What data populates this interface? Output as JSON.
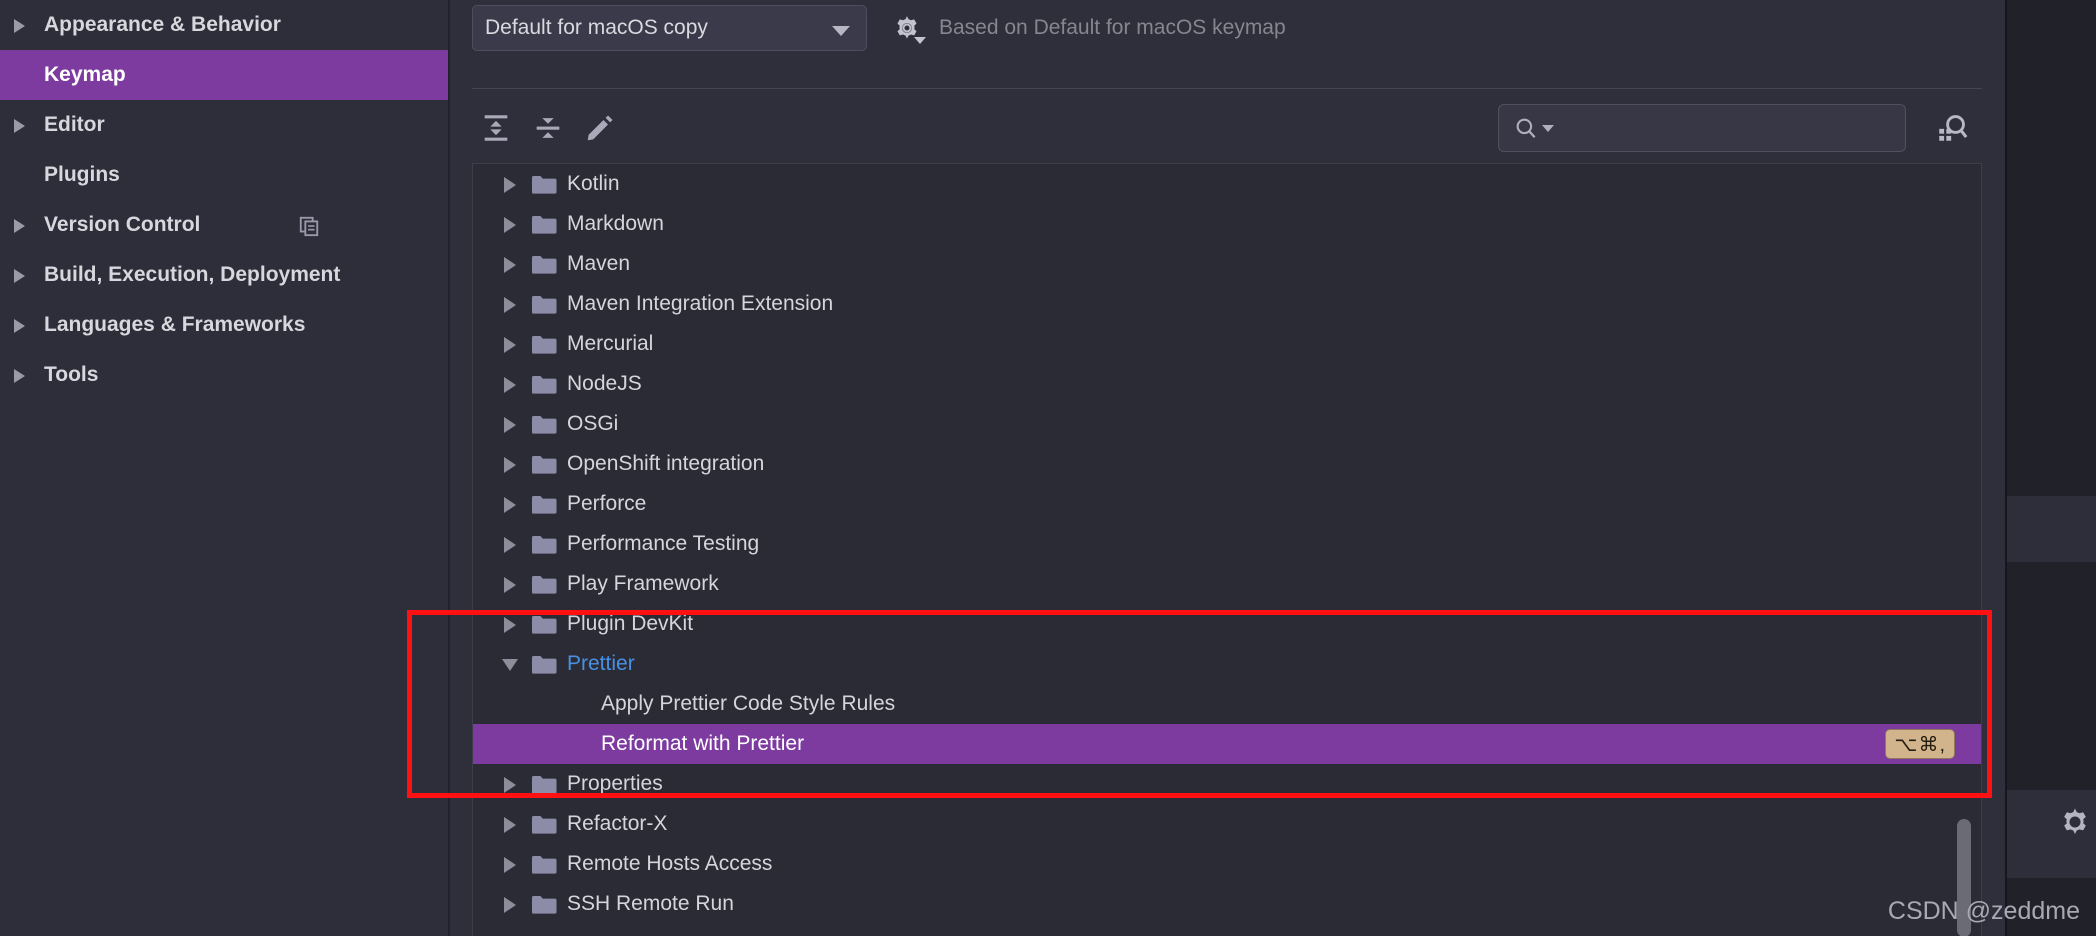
{
  "colors": {
    "accent_selection": "#7d3ba0",
    "panel_bg": "#2b2b35",
    "sidebar_bg": "#2e2e3a",
    "content_bg": "#2f2f3b",
    "link_blue": "#4a90e2",
    "shortcut_badge_bg": "#d2b48c",
    "annotation_red": "#ff1111",
    "text_primary": "#d5d5dc",
    "text_muted": "#86868f"
  },
  "sidebar": {
    "items": [
      {
        "label": "Appearance & Behavior",
        "expandable": true,
        "selected": false,
        "icon": ""
      },
      {
        "label": "Keymap",
        "expandable": false,
        "selected": true,
        "icon": ""
      },
      {
        "label": "Editor",
        "expandable": true,
        "selected": false,
        "icon": ""
      },
      {
        "label": "Plugins",
        "expandable": false,
        "selected": false,
        "icon": ""
      },
      {
        "label": "Version Control",
        "expandable": true,
        "selected": false,
        "icon": "copy-icon"
      },
      {
        "label": "Build, Execution, Deployment",
        "expandable": true,
        "selected": false,
        "icon": ""
      },
      {
        "label": "Languages & Frameworks",
        "expandable": true,
        "selected": false,
        "icon": ""
      },
      {
        "label": "Tools",
        "expandable": true,
        "selected": false,
        "icon": ""
      }
    ]
  },
  "header": {
    "keymap_combo_value": "Default for macOS copy",
    "gear_icon": "gear-icon",
    "based_on_text": "Based on Default for macOS keymap"
  },
  "toolbar": {
    "expand_all_icon": "expand-all-icon",
    "collapse_all_icon": "collapse-all-icon",
    "edit_icon": "pencil-edit-icon",
    "search_icon": "search-icon",
    "search_value": "",
    "search_placeholder": "",
    "find_by_shortcut_icon": "find-by-shortcut-icon"
  },
  "tree": {
    "rows": [
      {
        "label": "Kotlin",
        "type": "folder",
        "state": "closed",
        "selected": false,
        "shortcut": ""
      },
      {
        "label": "Markdown",
        "type": "folder",
        "state": "closed",
        "selected": false,
        "shortcut": ""
      },
      {
        "label": "Maven",
        "type": "folder",
        "state": "closed",
        "selected": false,
        "shortcut": ""
      },
      {
        "label": "Maven Integration Extension",
        "type": "folder",
        "state": "closed",
        "selected": false,
        "shortcut": ""
      },
      {
        "label": "Mercurial",
        "type": "folder",
        "state": "closed",
        "selected": false,
        "shortcut": ""
      },
      {
        "label": "NodeJS",
        "type": "folder",
        "state": "closed",
        "selected": false,
        "shortcut": ""
      },
      {
        "label": "OSGi",
        "type": "folder",
        "state": "closed",
        "selected": false,
        "shortcut": ""
      },
      {
        "label": "OpenShift integration",
        "type": "folder",
        "state": "closed",
        "selected": false,
        "shortcut": ""
      },
      {
        "label": "Perforce",
        "type": "folder",
        "state": "closed",
        "selected": false,
        "shortcut": ""
      },
      {
        "label": "Performance Testing",
        "type": "folder",
        "state": "closed",
        "selected": false,
        "shortcut": ""
      },
      {
        "label": "Play Framework",
        "type": "folder",
        "state": "closed",
        "selected": false,
        "shortcut": ""
      },
      {
        "label": "Plugin DevKit",
        "type": "folder",
        "state": "closed",
        "selected": false,
        "shortcut": ""
      },
      {
        "label": "Prettier",
        "type": "folder",
        "state": "open",
        "selected": false,
        "shortcut": ""
      },
      {
        "label": "Apply Prettier Code Style Rules",
        "type": "action",
        "state": "",
        "selected": false,
        "shortcut": ""
      },
      {
        "label": "Reformat with Prettier",
        "type": "action",
        "state": "",
        "selected": true,
        "shortcut": "⌥⌘,"
      },
      {
        "label": "Properties",
        "type": "folder",
        "state": "closed",
        "selected": false,
        "shortcut": ""
      },
      {
        "label": "Refactor-X",
        "type": "folder",
        "state": "closed",
        "selected": false,
        "shortcut": ""
      },
      {
        "label": "Remote Hosts Access",
        "type": "folder",
        "state": "closed",
        "selected": false,
        "shortcut": ""
      },
      {
        "label": "SSH Remote Run",
        "type": "folder",
        "state": "closed",
        "selected": false,
        "shortcut": ""
      }
    ]
  },
  "right_strip": {
    "gear_icon": "gear-icon"
  },
  "annotation": {
    "shape": "rectangle",
    "color": "#ff1111"
  },
  "watermark": {
    "text": "CSDN @zeddme"
  }
}
